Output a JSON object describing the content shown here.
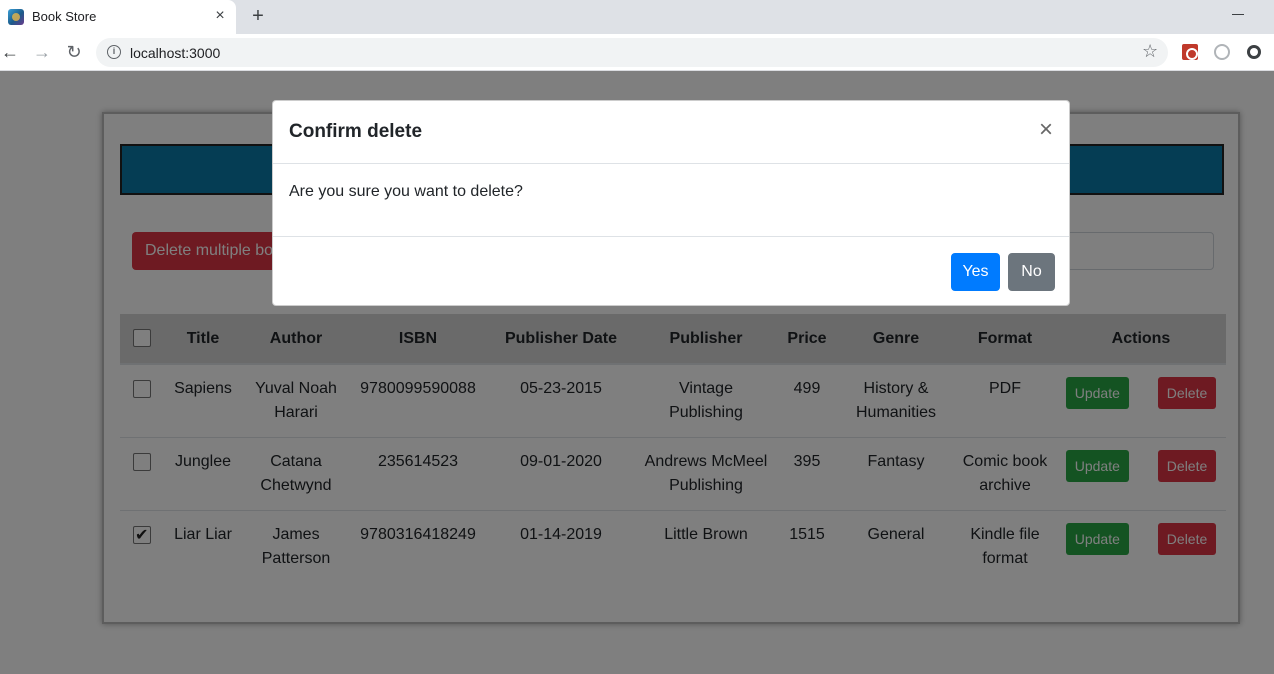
{
  "browser": {
    "tab_title": "Book Store",
    "tab_close": "×",
    "new_tab": "+",
    "url": "localhost:3000",
    "nav_back": "←",
    "nav_forward": "→",
    "nav_reload": "↻",
    "star": "☆"
  },
  "page": {
    "delete_multiple_label": "Delete multiple books",
    "search_placeholder": "",
    "table": {
      "headers": [
        "Title",
        "Author",
        "ISBN",
        "Publisher Date",
        "Publisher",
        "Price",
        "Genre",
        "Format",
        "Actions"
      ],
      "rows": [
        {
          "checked": false,
          "title": "Sapiens",
          "author": "Yuval Noah Harari",
          "isbn": "9780099590088",
          "publisher_date": "05-23-2015",
          "publisher": "Vintage Publishing",
          "price": "499",
          "genre": "History & Humanities",
          "format": "PDF"
        },
        {
          "checked": false,
          "title": "Junglee",
          "author": "Catana Chetwynd",
          "isbn": "235614523",
          "publisher_date": "09-01-2020",
          "publisher": "Andrews McMeel Publishing",
          "price": "395",
          "genre": "Fantasy",
          "format": "Comic book archive"
        },
        {
          "checked": true,
          "title": "Liar Liar",
          "author": "James Patterson",
          "isbn": "9780316418249",
          "publisher_date": "01-14-2019",
          "publisher": "Little Brown",
          "price": "1515",
          "genre": "General",
          "format": "Kindle file format"
        }
      ],
      "update_label": "Update",
      "delete_label": "Delete"
    }
  },
  "modal": {
    "title": "Confirm delete",
    "close": "×",
    "body": "Are you sure you want to delete?",
    "yes_label": "Yes",
    "no_label": "No"
  },
  "colors": {
    "header_band": "#0a7aa8",
    "danger": "#dc3545",
    "success": "#28a745",
    "primary": "#007bff",
    "secondary": "#6c757d"
  }
}
